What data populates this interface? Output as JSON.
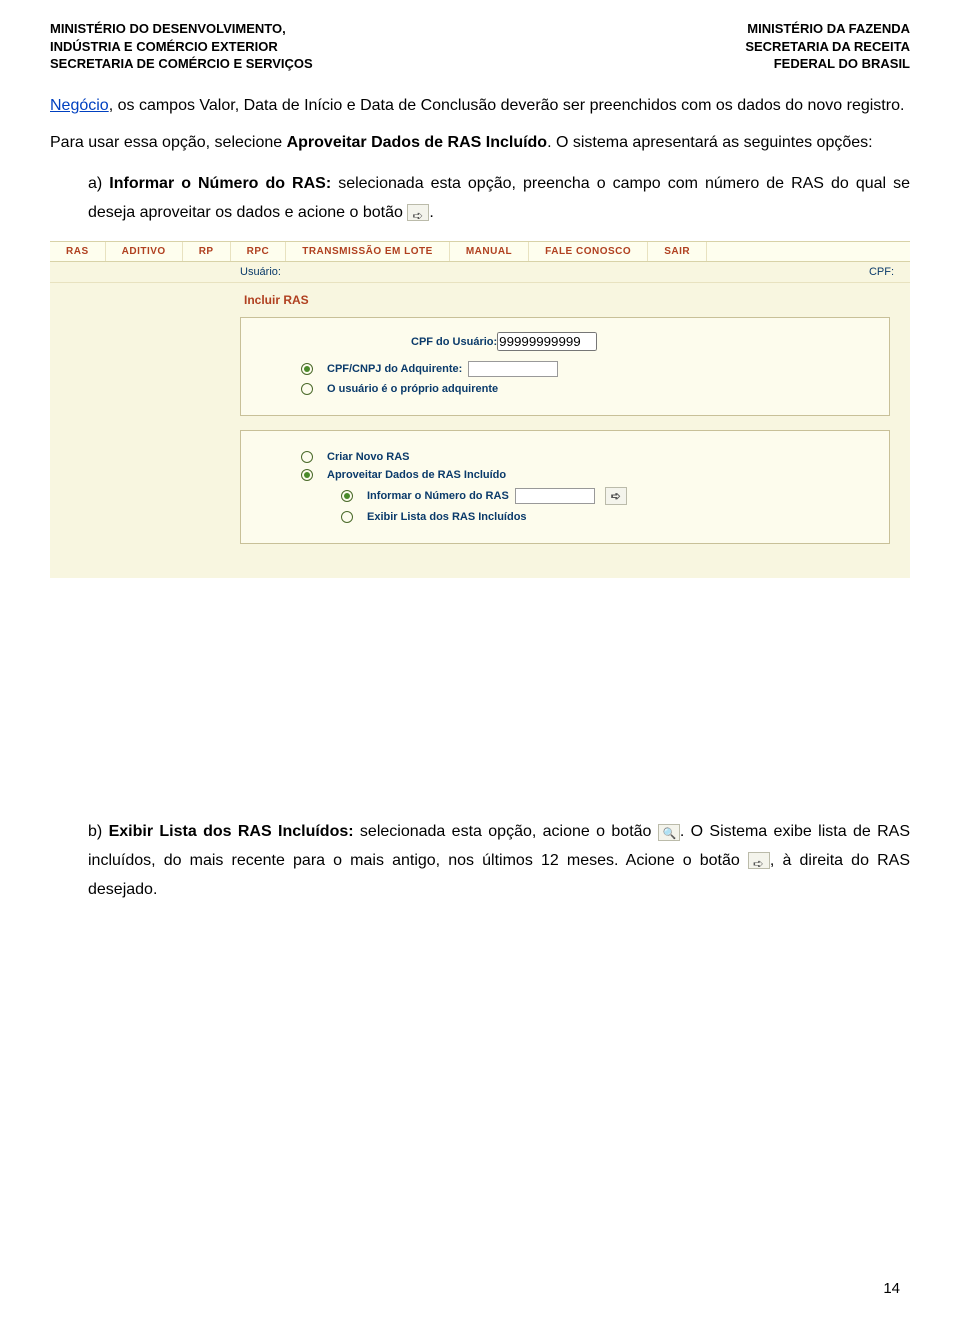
{
  "header": {
    "left": [
      "MINISTÉRIO DO DESENVOLVIMENTO,",
      "INDÚSTRIA E COMÉRCIO EXTERIOR",
      "SECRETARIA DE COMÉRCIO E SERVIÇOS"
    ],
    "right": [
      "MINISTÉRIO DA FAZENDA",
      "SECRETARIA DA RECEITA",
      "FEDERAL DO BRASIL"
    ]
  },
  "para1": {
    "link": "Negócio",
    "rest": ", os campos Valor, Data de Início e Data de Conclusão deverão ser preenchidos com os dados do novo registro."
  },
  "para2": {
    "part1": "Para usar essa opção, selecione ",
    "bold1": "Aproveitar Dados de RAS Incluído",
    "part2": ". O sistema apresentará as seguintes opções:"
  },
  "item_a": {
    "lead": "a) ",
    "bold": "Informar o Número do RAS:",
    "rest": " selecionada esta opção, preencha o campo com número de RAS do qual se deseja aproveitar os dados e acione o botão ",
    "tail": "."
  },
  "item_b": {
    "lead": "b) ",
    "bold": "Exibir Lista dos RAS Incluídos:",
    "rest1": " selecionada esta opção, acione o botão ",
    "rest2": ". O Sistema exibe lista de RAS incluídos, do mais recente para o mais antigo, nos últimos 12 meses. Acione o botão ",
    "rest3": ", à direita do RAS desejado."
  },
  "app": {
    "menu": [
      "RAS",
      "ADITIVO",
      "RP",
      "RPC",
      "TRANSMISSÃO EM LOTE",
      "MANUAL",
      "FALE CONOSCO",
      "SAIR"
    ],
    "userbar": {
      "usuario": "Usuário:",
      "cpf": "CPF:"
    },
    "title": "Incluir RAS",
    "panel1": {
      "cpf_label": "CPF do Usuário:",
      "cpf_value": "99999999999",
      "r1": "CPF/CNPJ do Adquirente:",
      "r2": "O usuário é o próprio adquirente"
    },
    "panel2": {
      "r1": "Criar Novo RAS",
      "r2": "Aproveitar Dados de RAS Incluído",
      "r2a": "Informar o Número do RAS",
      "r2b": "Exibir Lista dos RAS Incluídos"
    }
  },
  "page_number": "14"
}
